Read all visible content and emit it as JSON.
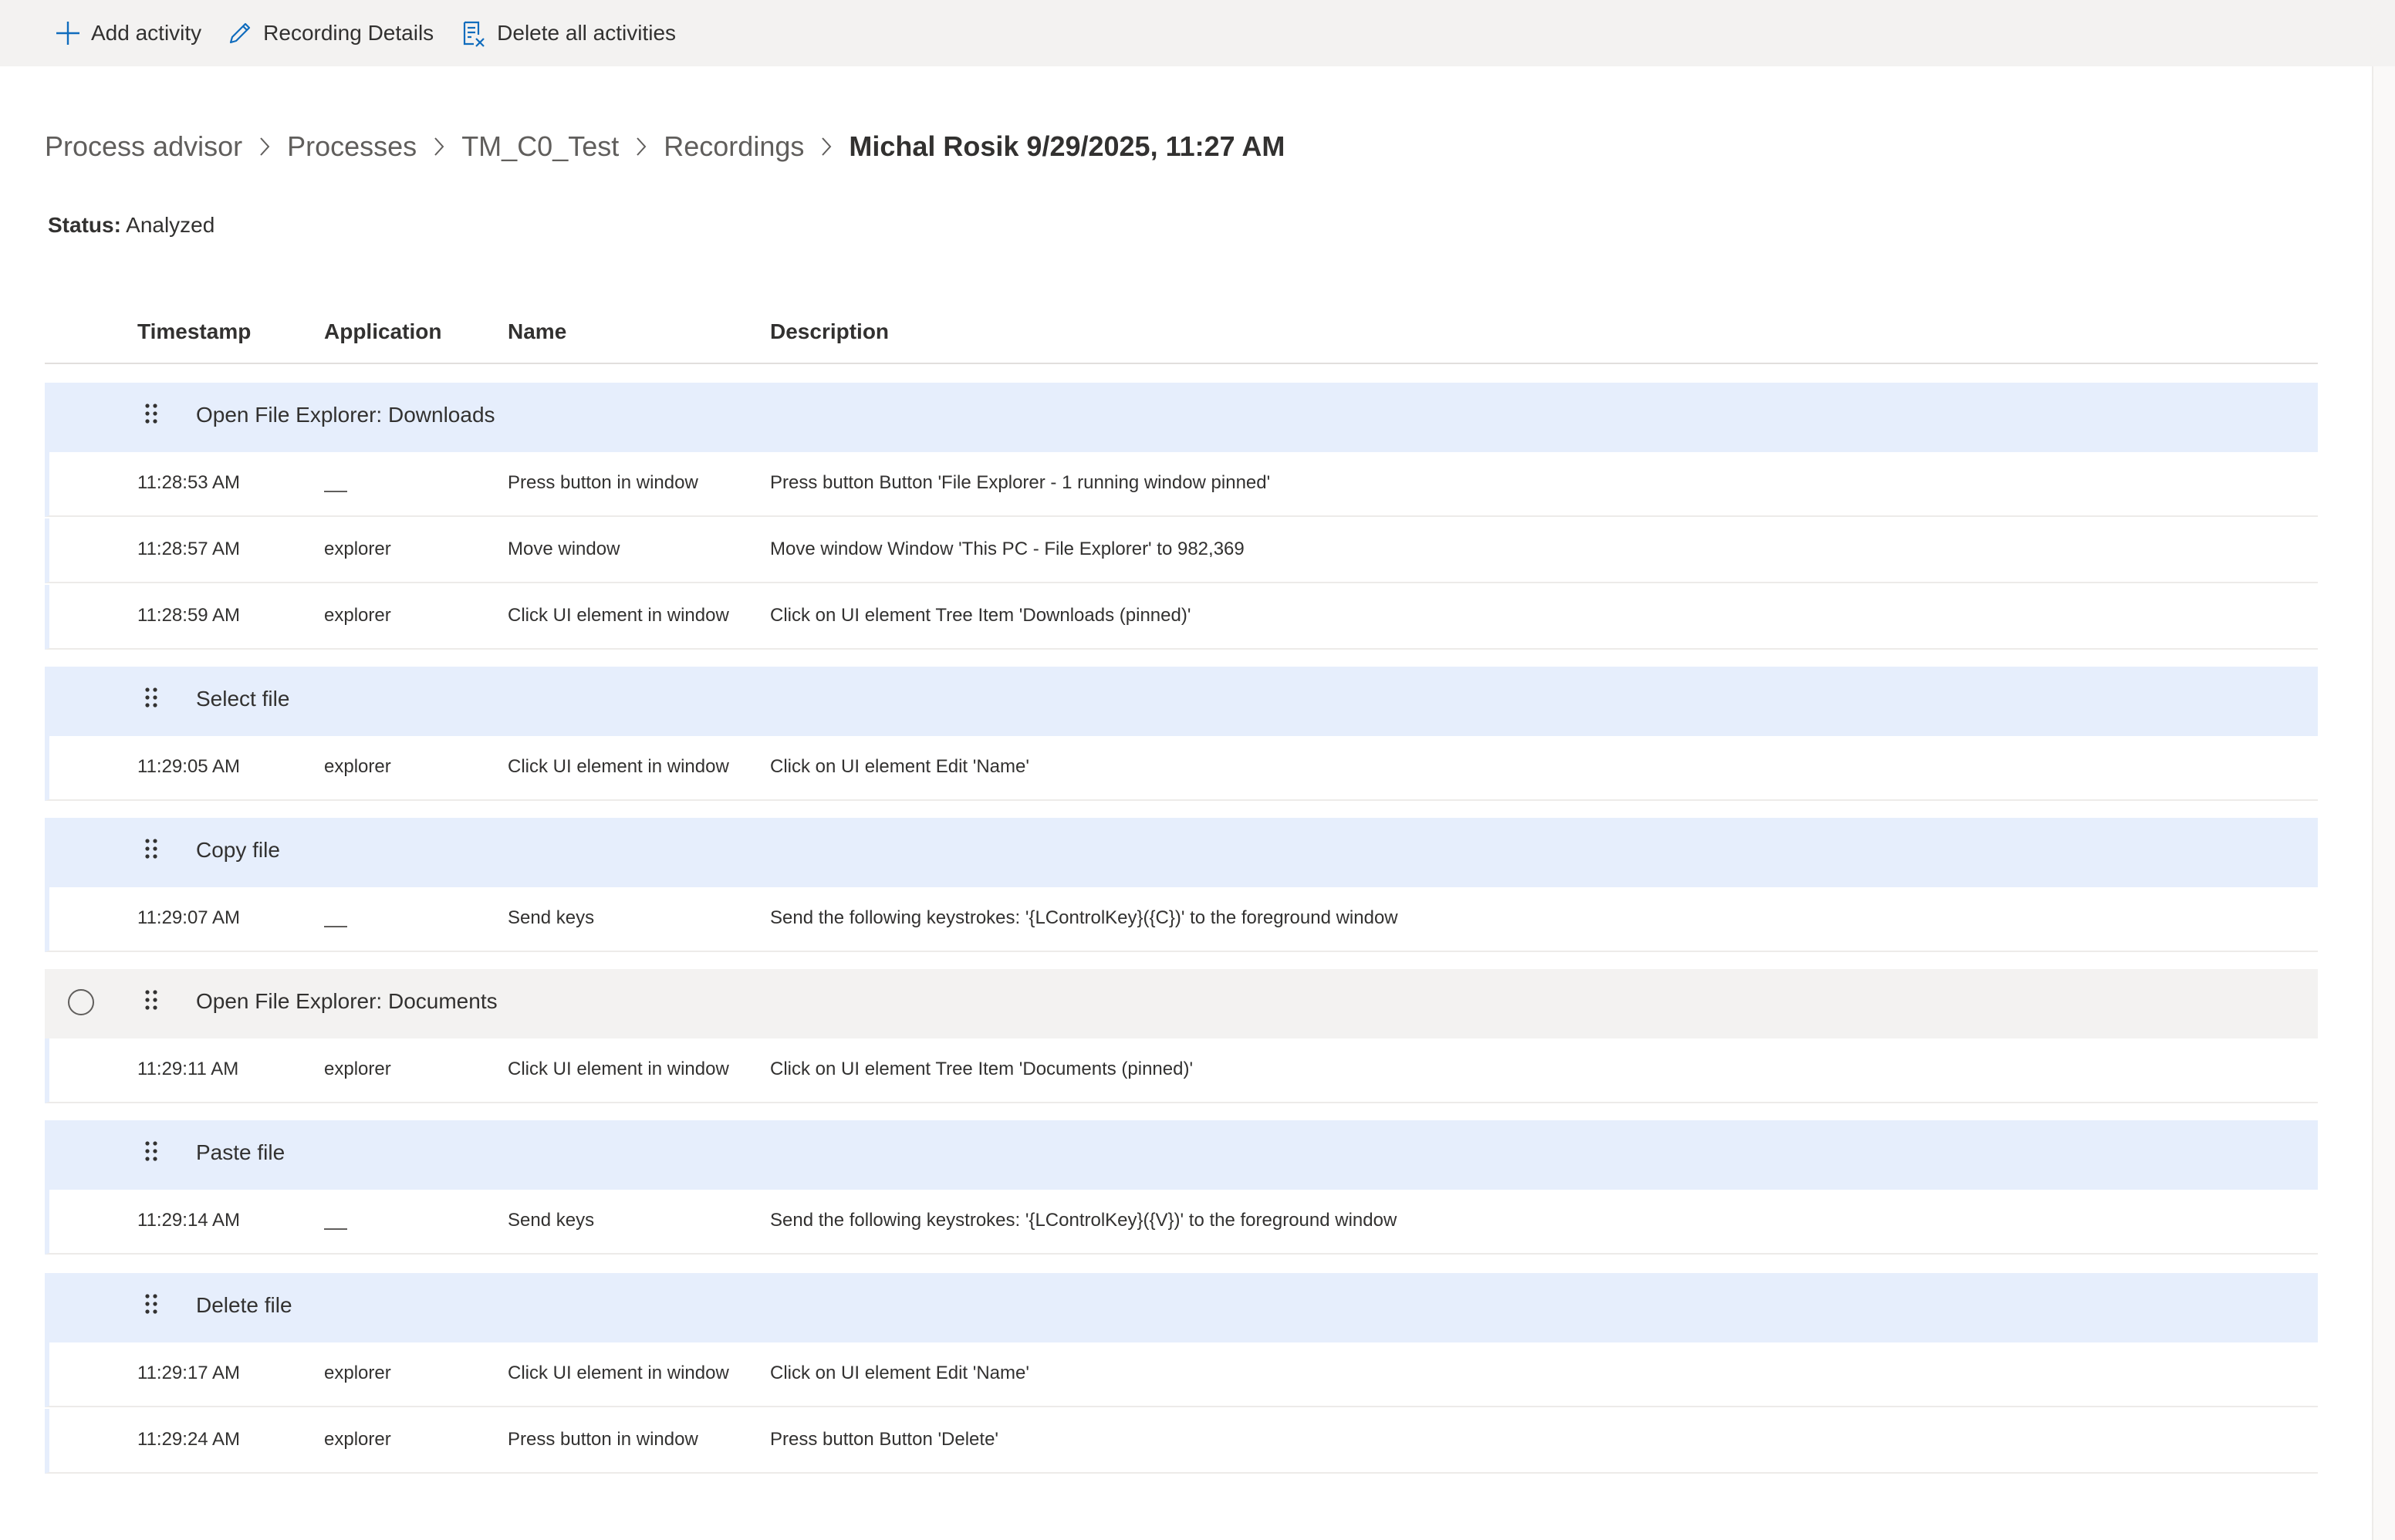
{
  "toolbar": {
    "add_activity": "Add activity",
    "recording_details": "Recording Details",
    "delete_all": "Delete all activities"
  },
  "breadcrumb": {
    "items": [
      "Process advisor",
      "Processes",
      "TM_C0_Test",
      "Recordings"
    ],
    "current": "Michal Rosik 9/29/2025, 11:27 AM"
  },
  "status": {
    "label": "Status:",
    "value": "Analyzed"
  },
  "table": {
    "columns": [
      "Timestamp",
      "Application",
      "Name",
      "Description"
    ],
    "groups": [
      {
        "title": "Open File Explorer: Downloads",
        "rows": [
          {
            "timestamp": "11:28:53 AM",
            "application": "",
            "name": "Press button in window",
            "description": "Press button Button 'File Explorer - 1 running window pinned'"
          },
          {
            "timestamp": "11:28:57 AM",
            "application": "explorer",
            "name": "Move window",
            "description": "Move window Window 'This PC - File Explorer' to 982,369"
          },
          {
            "timestamp": "11:28:59 AM",
            "application": "explorer",
            "name": "Click UI element in window",
            "description": "Click on UI element Tree Item 'Downloads (pinned)'"
          }
        ]
      },
      {
        "title": "Select file",
        "rows": [
          {
            "timestamp": "11:29:05 AM",
            "application": "explorer",
            "name": "Click UI element in window",
            "description": "Click on UI element Edit 'Name'"
          }
        ]
      },
      {
        "title": "Copy file",
        "rows": [
          {
            "timestamp": "11:29:07 AM",
            "application": "",
            "name": "Send keys",
            "description": "Send the following keystrokes: '{LControlKey}({C})' to the foreground window"
          }
        ]
      },
      {
        "title": "Open File Explorer: Documents",
        "hovered": true,
        "rows": [
          {
            "timestamp": "11:29:11 AM",
            "application": "explorer",
            "name": "Click UI element in window",
            "description": "Click on UI element Tree Item 'Documents (pinned)'"
          }
        ]
      },
      {
        "title": "Paste file",
        "rows": [
          {
            "timestamp": "11:29:14 AM",
            "application": "",
            "name": "Send keys",
            "description": "Send the following keystrokes: '{LControlKey}({V})' to the foreground window"
          }
        ]
      },
      {
        "title": "Delete file",
        "rows": [
          {
            "timestamp": "11:29:17 AM",
            "application": "explorer",
            "name": "Click UI element in window",
            "description": "Click on UI element Edit 'Name'"
          },
          {
            "timestamp": "11:29:24 AM",
            "application": "explorer",
            "name": "Press button in window",
            "description": "Press button Button 'Delete'"
          }
        ]
      }
    ]
  },
  "icons": {
    "add": "plus-icon",
    "details": "pencil-icon",
    "delete": "delete-list-icon",
    "grip": "drag-handle-icon",
    "chevron": "chevron-right-icon"
  },
  "colors": {
    "group_bg": "#e6eefc",
    "group_hover_bg": "#f3f2f1",
    "accent": "#0f6cbd",
    "toolbar_bg": "#f3f2f1"
  }
}
